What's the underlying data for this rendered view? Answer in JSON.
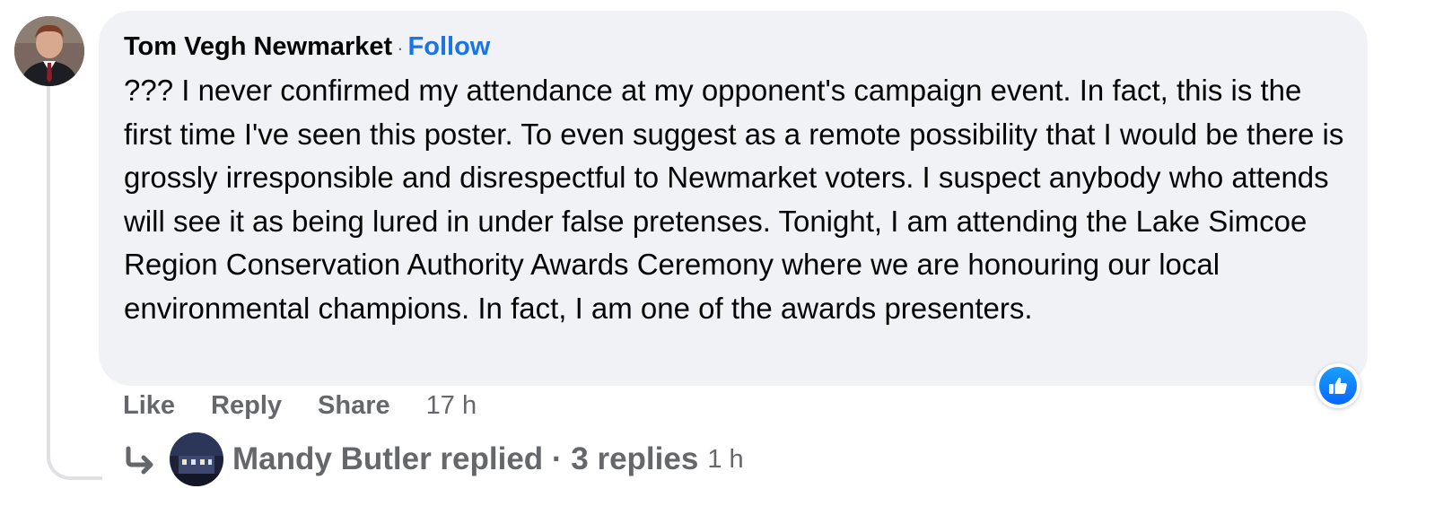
{
  "comment": {
    "author": "Tom Vegh Newmarket",
    "separator": "·",
    "follow_label": "Follow",
    "text": "??? I never confirmed my attendance at my opponent's campaign event. In fact, this is the first time I've seen this poster. To even suggest as a remote possibility that I would be there is grossly irresponsible and disrespectful to Newmarket voters. I suspect anybody who attends will see it as being lured in under false pretenses. Tonight, I am attending the Lake Simcoe Region Conservation Authority Awards Ceremony where we are honouring our local environmental champions. In fact, I am one of the awards presenters.",
    "reaction_icon": "thumbs-up-icon",
    "colors": {
      "bubble": "#f0f2f5",
      "link": "#1b74e4",
      "secondary_text": "#65676b",
      "like_blue": "#0866ff"
    }
  },
  "actions": {
    "like_label": "Like",
    "reply_label": "Reply",
    "share_label": "Share",
    "timestamp": "17 h"
  },
  "replies": {
    "icon": "reply-arrow-icon",
    "text": "Mandy Butler replied · 3 replies",
    "time": "1 h"
  }
}
